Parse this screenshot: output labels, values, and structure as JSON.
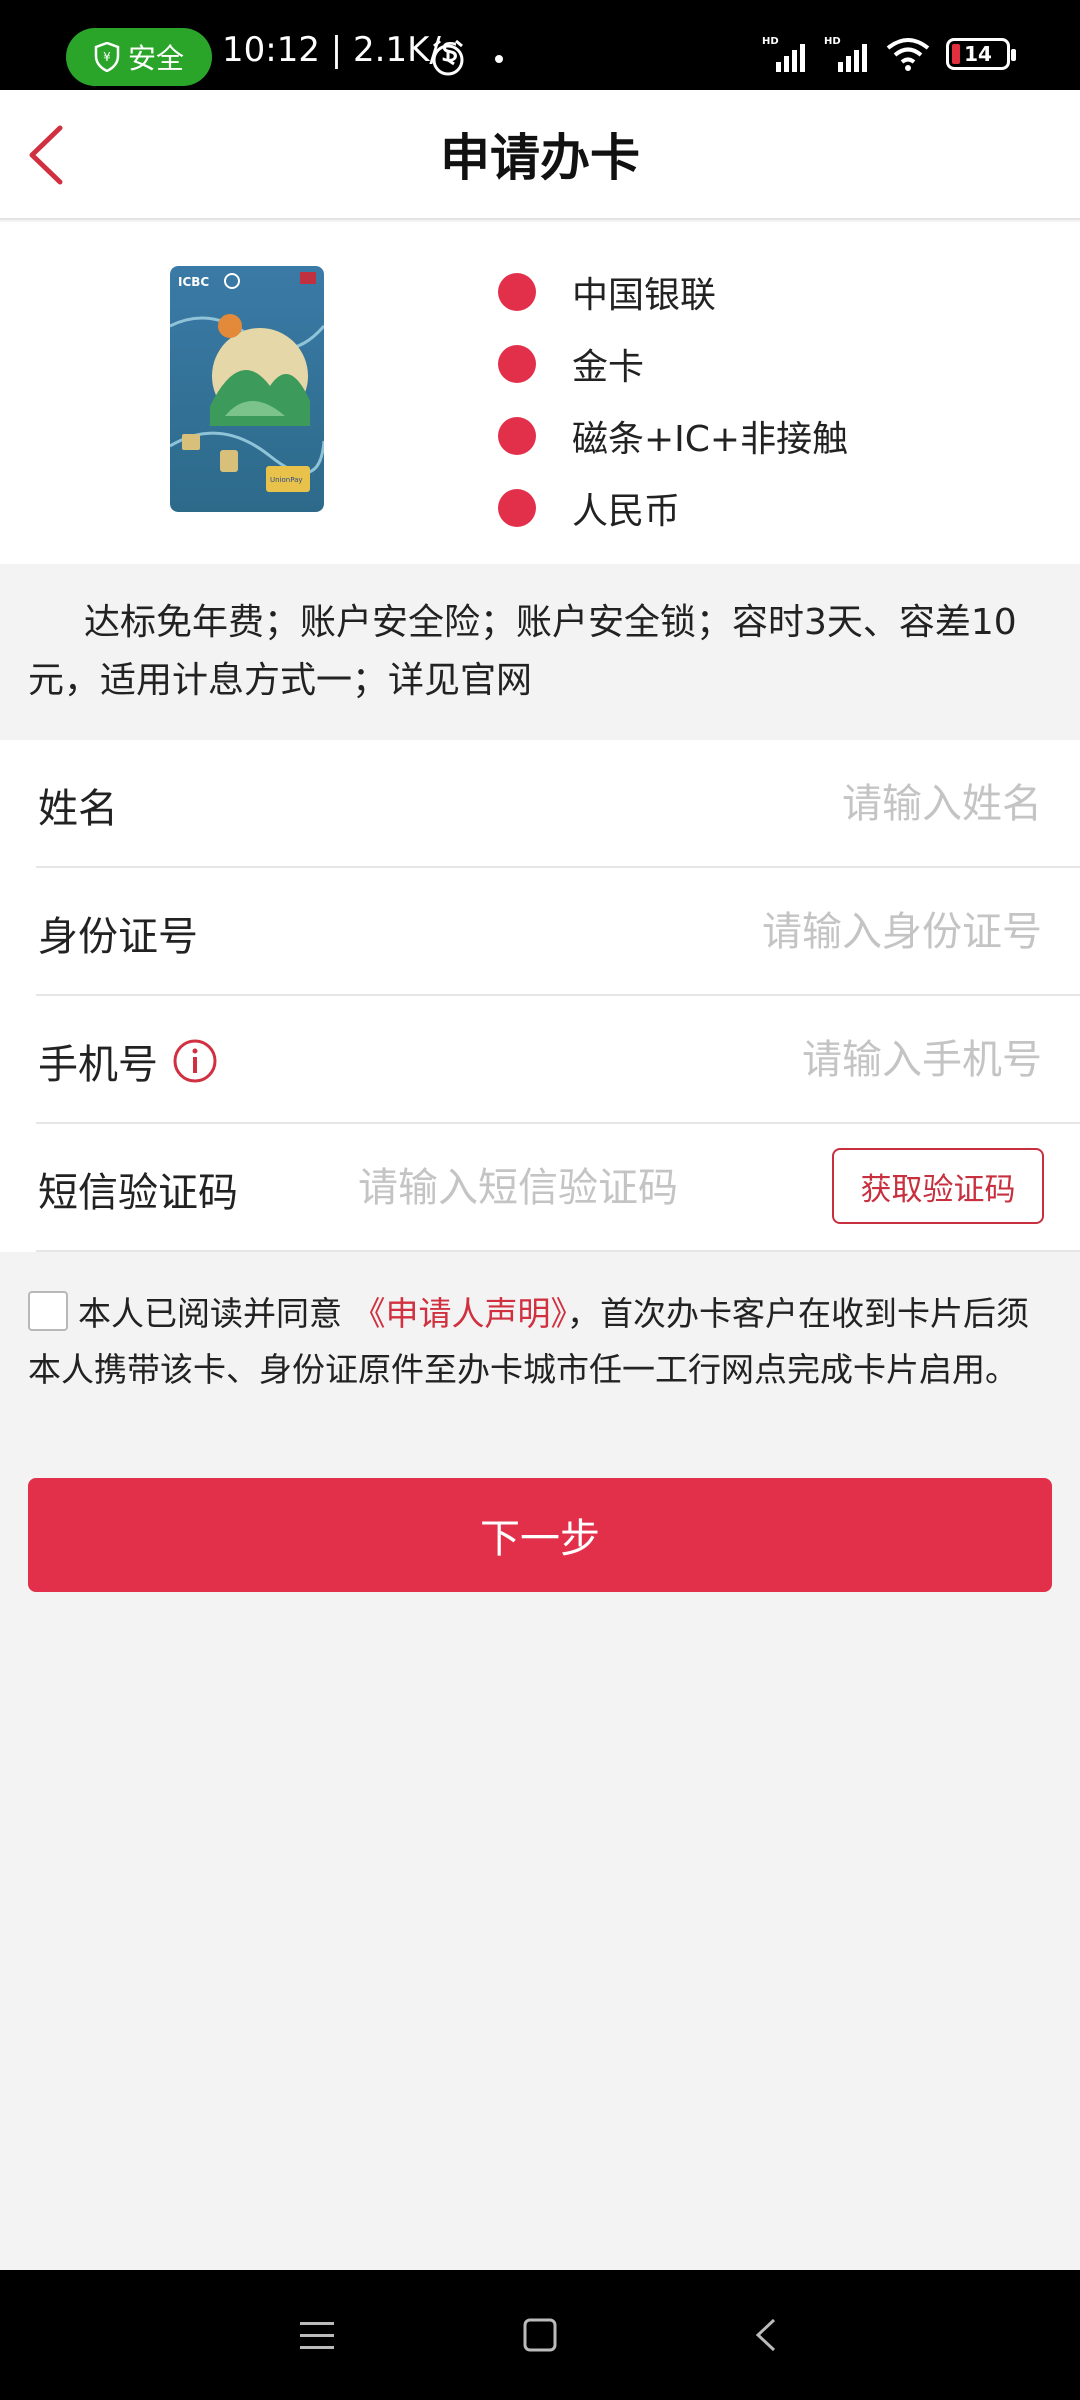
{
  "status_bar": {
    "safe_label": "安全",
    "time_speed": "10:12 | 2.1K/s",
    "battery": "14"
  },
  "header": {
    "title": "申请办卡"
  },
  "card": {
    "features": [
      "中国银联",
      "金卡",
      "磁条+IC+非接触",
      "人民币"
    ]
  },
  "description": "达标免年费；账户安全险；账户安全锁；容时3天、容差10元，适用计息方式一；详见官网",
  "form": {
    "name_label": "姓名",
    "name_placeholder": "请输入姓名",
    "id_label": "身份证号",
    "id_placeholder": "请输入身份证号",
    "phone_label": "手机号",
    "phone_placeholder": "请输入手机号",
    "sms_label": "短信验证码",
    "sms_placeholder": "请输入短信验证码",
    "sms_button": "获取验证码"
  },
  "agreement": {
    "prefix": "本人已阅读并同意",
    "link": "《申请人声明》",
    "suffix": "，首次办卡客户在收到卡片后须本人携带该卡、身份证原件至办卡城市任一工行网点完成卡片启用。"
  },
  "next_button": "下一步",
  "colors": {
    "accent": "#e3304a",
    "status_safe": "#2aa52a"
  }
}
